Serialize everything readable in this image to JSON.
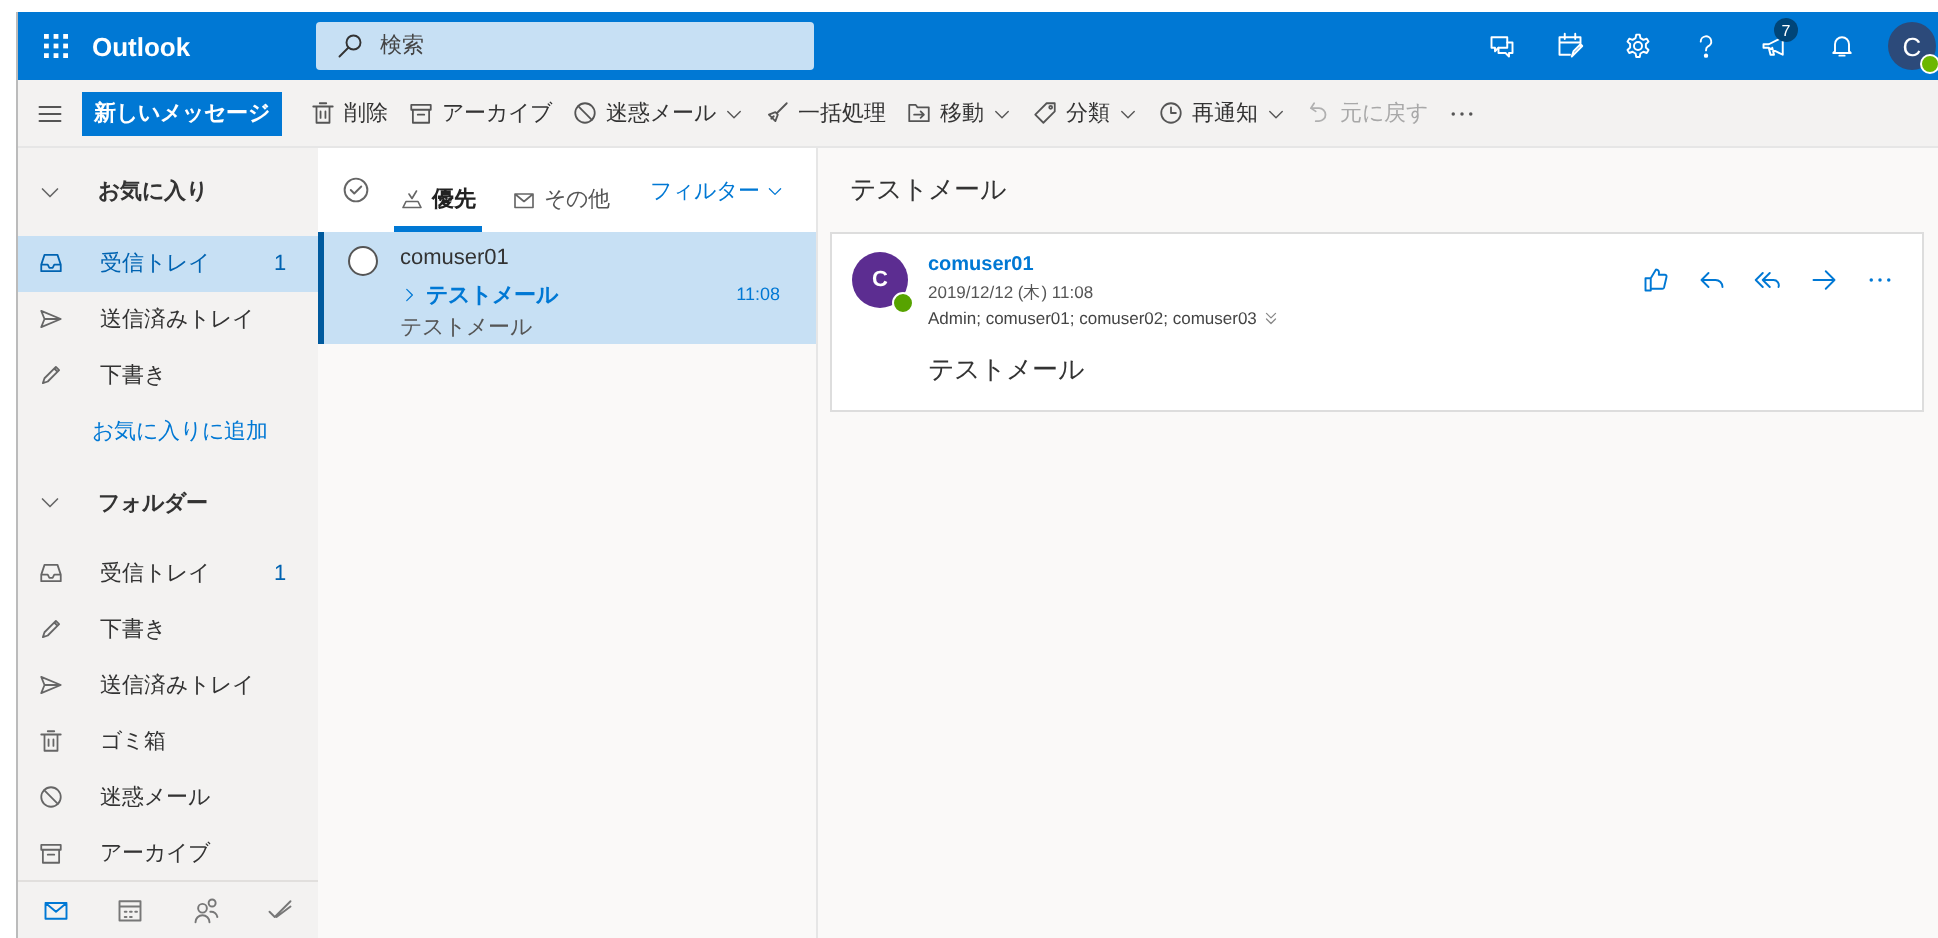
{
  "app": {
    "name": "Outlook"
  },
  "search": {
    "placeholder": "検索"
  },
  "header_icons": [
    {
      "kind": "chat"
    },
    {
      "kind": "calendar-edit"
    },
    {
      "kind": "settings"
    },
    {
      "kind": "help"
    },
    {
      "kind": "megaphone",
      "badge": "7"
    },
    {
      "kind": "bell"
    }
  ],
  "account": {
    "initial": "C",
    "online": true
  },
  "new_message": "新しいメッセージ",
  "toolbar": [
    {
      "kind": "trash",
      "label": "削除",
      "dropdown": false,
      "disabled": false
    },
    {
      "kind": "archive",
      "label": "アーカイブ",
      "dropdown": false,
      "disabled": false
    },
    {
      "kind": "block",
      "label": "迷惑メール",
      "dropdown": true,
      "disabled": false
    },
    {
      "kind": "broom",
      "label": "一括処理",
      "dropdown": false,
      "disabled": false
    },
    {
      "kind": "move",
      "label": "移動",
      "dropdown": true,
      "disabled": false
    },
    {
      "kind": "tag",
      "label": "分類",
      "dropdown": true,
      "disabled": false
    },
    {
      "kind": "clock",
      "label": "再通知",
      "dropdown": true,
      "disabled": false
    },
    {
      "kind": "undo",
      "label": "元に戻す",
      "dropdown": false,
      "disabled": true
    },
    {
      "kind": "more"
    }
  ],
  "favorites": {
    "label": "お気に入り",
    "expanded": true,
    "items": [
      {
        "kind": "inbox",
        "label": "受信トレイ",
        "count": "1",
        "selected": true
      },
      {
        "kind": "send",
        "label": "送信済みトレイ",
        "selected": false
      },
      {
        "kind": "pencil",
        "label": "下書き",
        "selected": false
      }
    ],
    "add_link": "お気に入りに追加"
  },
  "folders": {
    "label": "フォルダー",
    "expanded": true,
    "items": [
      {
        "kind": "inbox",
        "label": "受信トレイ",
        "count": "1",
        "selected": false
      },
      {
        "kind": "pencil",
        "label": "下書き",
        "selected": false
      },
      {
        "kind": "send",
        "label": "送信済みトレイ",
        "selected": false
      },
      {
        "kind": "trash",
        "label": "ゴミ箱",
        "selected": false
      },
      {
        "kind": "block",
        "label": "迷惑メール",
        "selected": false
      },
      {
        "kind": "archive",
        "label": "アーカイブ",
        "selected": false
      }
    ]
  },
  "bottom_nav": [
    {
      "kind": "mail",
      "selected": true
    },
    {
      "kind": "calendar",
      "selected": false
    },
    {
      "kind": "people",
      "selected": false
    },
    {
      "kind": "todo",
      "selected": false
    }
  ],
  "list": {
    "tabs": [
      {
        "kind": "focused",
        "label": "優先",
        "selected": true
      },
      {
        "kind": "mail",
        "label": "その他",
        "selected": false
      }
    ],
    "filter": "フィルター",
    "messages": [
      {
        "sender": "comuser01",
        "subject": "テストメール",
        "preview": "テストメール",
        "time": "11:08",
        "selected": true,
        "unread": true
      }
    ]
  },
  "reading": {
    "subject": "テストメール",
    "sender": "comuser01",
    "initial": "C",
    "online": true,
    "date": "2019/12/12 (木) 11:08",
    "recipients": "Admin; comuser01; comuser02; comuser03",
    "body": "テストメール",
    "actions": [
      {
        "kind": "like"
      },
      {
        "kind": "reply"
      },
      {
        "kind": "reply-all"
      },
      {
        "kind": "forward"
      },
      {
        "kind": "more"
      }
    ]
  }
}
